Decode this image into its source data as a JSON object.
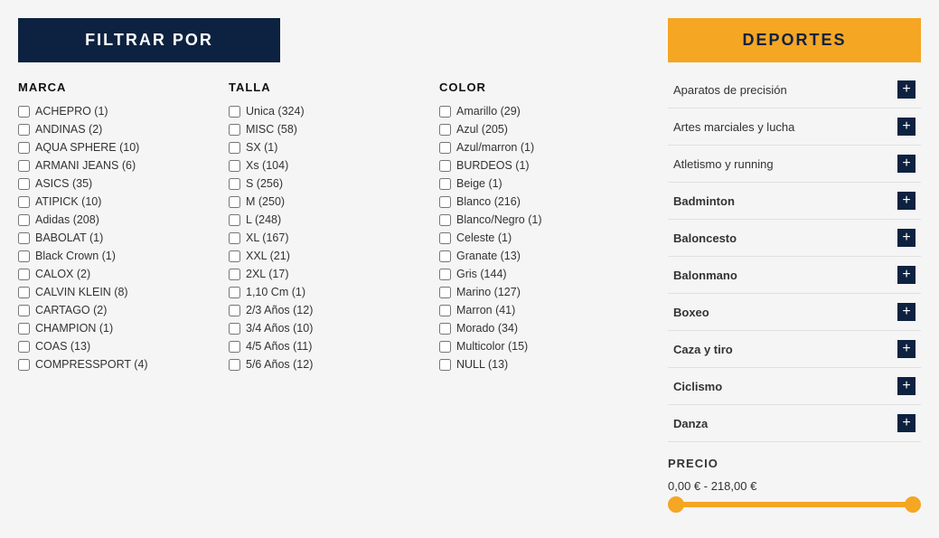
{
  "filter_header": "FILTRAR POR",
  "deportes_header": "DEPORTES",
  "marca": {
    "label": "MARCA",
    "items": [
      "ACHEPRO (1)",
      "ANDINAS (2)",
      "AQUA SPHERE (10)",
      "ARMANI JEANS (6)",
      "ASICS (35)",
      "ATIPICK (10)",
      "Adidas (208)",
      "BABOLAT (1)",
      "Black Crown (1)",
      "CALOX (2)",
      "CALVIN KLEIN (8)",
      "CARTAGO (2)",
      "CHAMPION (1)",
      "COAS (13)",
      "COMPRESSPORT (4)"
    ]
  },
  "talla": {
    "label": "TALLA",
    "items": [
      "Unica (324)",
      "MISC (58)",
      "SX (1)",
      "Xs (104)",
      "S (256)",
      "M (250)",
      "L (248)",
      "XL (167)",
      "XXL (21)",
      "2XL (17)",
      "1,10 Cm (1)",
      "2/3 Años (12)",
      "3/4 Años (10)",
      "4/5 Años (11)",
      "5/6 Años (12)"
    ]
  },
  "color": {
    "label": "COLOR",
    "items": [
      "Amarillo (29)",
      "Azul (205)",
      "Azul/marron (1)",
      "BURDEOS (1)",
      "Beige (1)",
      "Blanco (216)",
      "Blanco/Negro (1)",
      "Celeste (1)",
      "Granate (13)",
      "Gris (144)",
      "Marino (127)",
      "Marron (41)",
      "Morado (34)",
      "Multicolor (15)",
      "NULL (13)"
    ]
  },
  "deportes": {
    "items": [
      {
        "label": "Aparatos de precisión",
        "bold": false
      },
      {
        "label": "Artes marciales y lucha",
        "bold": false
      },
      {
        "label": "Atletismo y running",
        "bold": false
      },
      {
        "label": "Badminton",
        "bold": true
      },
      {
        "label": "Baloncesto",
        "bold": true
      },
      {
        "label": "Balonmano",
        "bold": true
      },
      {
        "label": "Boxeo",
        "bold": true
      },
      {
        "label": "Caza y tiro",
        "bold": true
      },
      {
        "label": "Ciclismo",
        "bold": true
      },
      {
        "label": "Danza",
        "bold": true
      }
    ]
  },
  "precio": {
    "label": "PRECIO",
    "range": "0,00 € - 218,00 €"
  }
}
